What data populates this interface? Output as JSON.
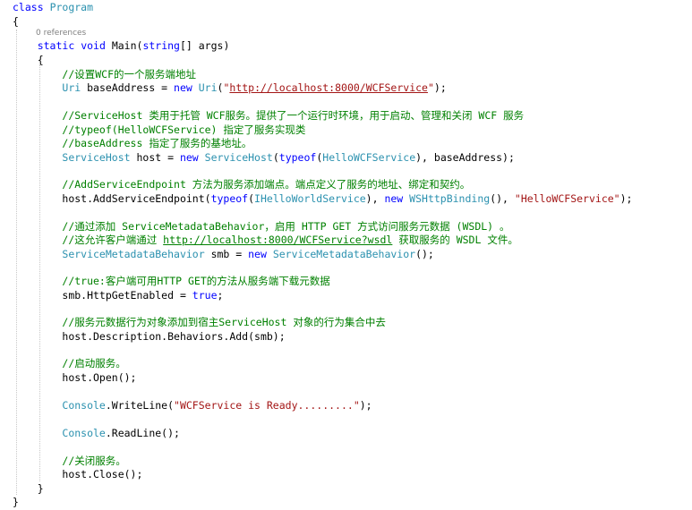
{
  "code": {
    "class_kw": "class",
    "class_name": "Program",
    "open_brace": "{",
    "close_brace": "}",
    "references_lens": "0 references",
    "main_static": "static",
    "main_void": "void",
    "main_sig": " Main(",
    "main_string": "string",
    "main_args": "[] args)",
    "comment_1": "//设置WCF的一个服务端地址",
    "uri_type": "Uri",
    "uri_decl": " baseAddress = ",
    "new_kw": "new",
    "uri_ctor": "Uri",
    "uri_open": "(",
    "uri_quote_open": "\"",
    "uri_url": "http://localhost:8000/WCFService",
    "uri_quote_close": "\"",
    "uri_close": ");",
    "comment_2": "//ServiceHost 类用于托管 WCF服务。提供了一个运行时环境，用于启动、管理和关闭 WCF 服务",
    "comment_3": "//typeof(HelloWCFService) 指定了服务实现类",
    "comment_4": "//baseAddress 指定了服务的基地址。",
    "sh_type": "ServiceHost",
    "sh_decl": " host = ",
    "sh_ctor": "ServiceHost",
    "sh_open": "(",
    "typeof_kw": "typeof",
    "sh_paren": "(",
    "hello_type": "HelloWCFService",
    "sh_rest": "), baseAddress);",
    "comment_5": "//AddServiceEndpoint 方法为服务添加端点。端点定义了服务的地址、绑定和契约。",
    "ep_call": "host.AddServiceEndpoint(",
    "ep_typeof": "typeof",
    "ep_paren": "(",
    "ep_iface": "IHelloWorldService",
    "ep_mid": "), ",
    "ep_new": "new",
    "ep_binding": "WSHttpBinding",
    "ep_after": "(), ",
    "ep_str": "\"HelloWCFService\"",
    "ep_end": ");",
    "comment_6": "//通过添加 ServiceMetadataBehavior，启用 HTTP GET 方式访问服务元数据 (WSDL) 。",
    "comment_7_pre": "//这允许客户端通过 ",
    "comment_7_url": "http://localhost:8000/WCFService?wsdl",
    "comment_7_post": " 获取服务的 WSDL 文件。",
    "smb_type": "ServiceMetadataBehavior",
    "smb_decl": " smb = ",
    "smb_new": "new",
    "smb_ctor": "ServiceMetadataBehavior",
    "smb_end": "();",
    "comment_8": "//true:客户端可用HTTP GET的方法从服务端下载元数据",
    "get_stmt": "smb.HttpGetEnabled = ",
    "true_kw": "true",
    "get_end": ";",
    "comment_9": "//服务元数据行为对象添加到宿主ServiceHost 对象的行为集合中去",
    "behaviors_stmt": "host.Description.Behaviors.Add(smb);",
    "comment_10": "//启动服务。",
    "open_stmt": "host.Open();",
    "console_type": "Console",
    "writeline_call": ".WriteLine(",
    "writeline_str": "\"WCFService is Ready.........\"",
    "writeline_end": ");",
    "readline_call": ".ReadLine();",
    "comment_11": "//关闭服务。",
    "close_stmt": "host.Close();"
  }
}
